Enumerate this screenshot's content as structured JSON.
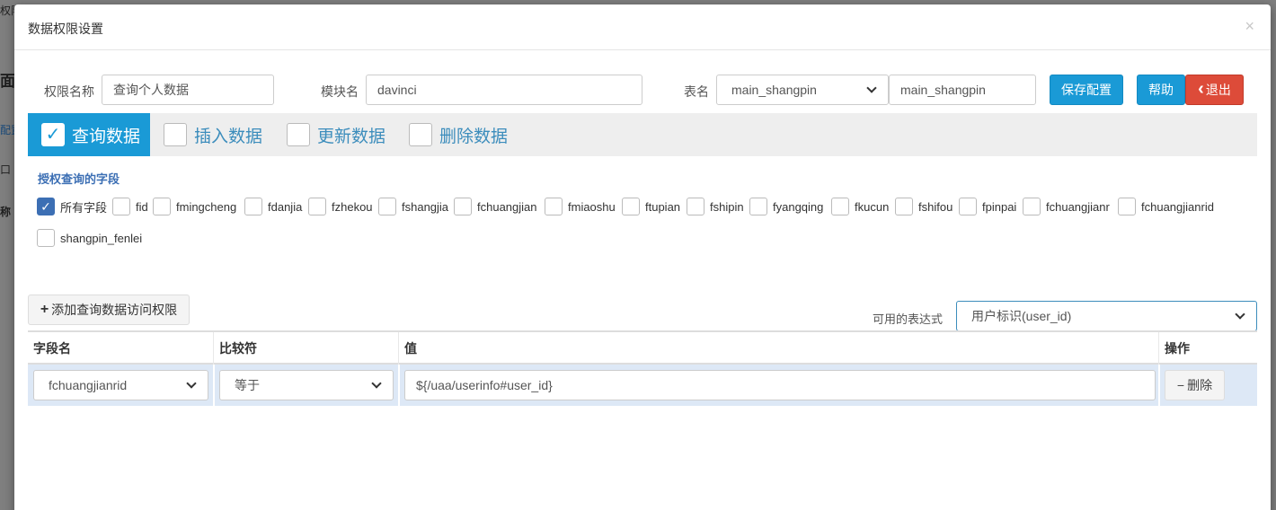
{
  "background": {
    "fragments": [
      "权限配",
      "面前",
      "配置",
      "口",
      "称"
    ]
  },
  "modal": {
    "title": "数据权限设置",
    "close_symbol": "×"
  },
  "form": {
    "permission_name_label": "权限名称",
    "permission_name_value": "查询个人数据",
    "module_name_label": "模块名",
    "module_name_value": "davinci",
    "table_name_label": "表名",
    "table_select_value": "main_shangpin",
    "table_input_value": "main_shangpin"
  },
  "buttons": {
    "save": "保存配置",
    "help": "帮助",
    "exit": "退出",
    "exit_icon": "‹"
  },
  "tabs": [
    {
      "label": "查询数据",
      "checked": true
    },
    {
      "label": "插入数据",
      "checked": false
    },
    {
      "label": "更新数据",
      "checked": false
    },
    {
      "label": "删除数据",
      "checked": false
    }
  ],
  "authorized_fields": {
    "title": "授权查询的字段",
    "items": [
      {
        "label": "所有字段",
        "checked": true
      },
      {
        "label": "fid",
        "checked": false
      },
      {
        "label": "fmingcheng",
        "checked": false
      },
      {
        "label": "fdanjia",
        "checked": false
      },
      {
        "label": "fzhekou",
        "checked": false
      },
      {
        "label": "fshangjia",
        "checked": false
      },
      {
        "label": "fchuangjian",
        "checked": false
      },
      {
        "label": "fmiaoshu",
        "checked": false
      },
      {
        "label": "ftupian",
        "checked": false
      },
      {
        "label": "fshipin",
        "checked": false
      },
      {
        "label": "fyangqing",
        "checked": false
      },
      {
        "label": "fkucun",
        "checked": false
      },
      {
        "label": "fshifou",
        "checked": false
      },
      {
        "label": "fpinpai",
        "checked": false
      },
      {
        "label": "fchuangjianr",
        "checked": false
      },
      {
        "label": "fchuangjianrid",
        "checked": false
      },
      {
        "label": "shangpin_fenlei",
        "checked": false
      }
    ]
  },
  "access": {
    "add_button_label": "添加查询数据访问权限",
    "add_icon": "+",
    "expression_label": "可用的表达式",
    "expression_value": "用户标识(user_id)"
  },
  "table": {
    "headers": [
      "字段名",
      "比较符",
      "值",
      "操作"
    ],
    "rows": [
      {
        "field": "fchuangjianrid",
        "operator": "等于",
        "value": "${/uaa/userinfo#user_id}",
        "action_label": "删除",
        "action_icon": "−"
      }
    ]
  }
}
